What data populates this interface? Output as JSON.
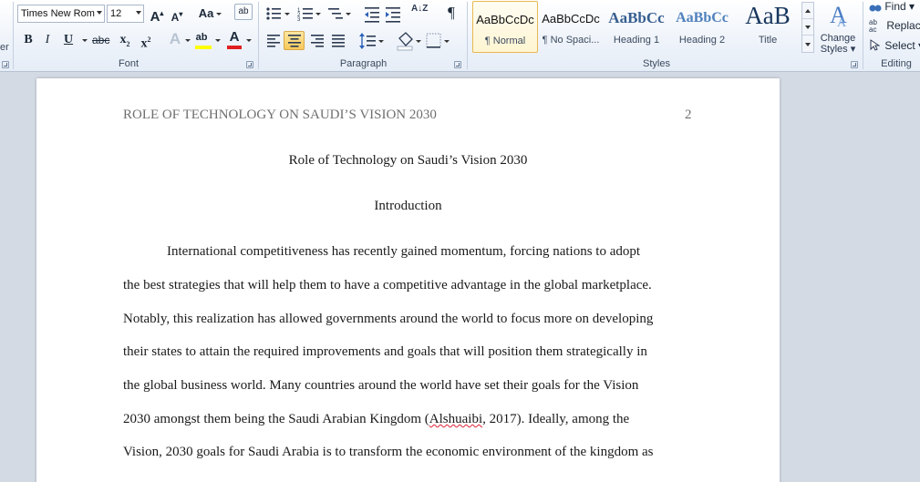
{
  "ribbon": {
    "font": {
      "name_value": "Times New Rom",
      "size_value": "12",
      "label": "Font",
      "grow_glyph": "A",
      "shrink_glyph": "A",
      "case_glyph": "Aa",
      "bold_glyph": "B",
      "italic_glyph": "I",
      "underline_glyph": "U",
      "strike_glyph": "abc",
      "subscript_glyph": "x",
      "superscript_glyph": "x",
      "sub_mark": "2",
      "sup_mark": "2",
      "highlight_glyph": "ab",
      "color_glyph": "A",
      "highlight_color": "#ffff00",
      "font_color": "#e02020"
    },
    "paragraph": {
      "label": "Paragraph",
      "pilcrow": "¶",
      "sort_glyph": "A↓Z"
    },
    "styles": {
      "label": "Styles",
      "tiles": [
        {
          "preview": "AaBbCcDc",
          "name": "¶ Normal"
        },
        {
          "preview": "AaBbCcDc",
          "name": "¶ No Spaci..."
        },
        {
          "preview": "AaBbCc",
          "name": "Heading 1"
        },
        {
          "preview": "AaBbCc",
          "name": "Heading 2"
        },
        {
          "preview": "AaB",
          "name": "Title"
        }
      ],
      "change_styles_line1": "Change",
      "change_styles_line2": "Styles",
      "heading_color": "#365f91"
    },
    "editing": {
      "label": "Editing",
      "find": "Find",
      "replace": "Replace",
      "select": "Select",
      "clip_text": "er"
    }
  },
  "document": {
    "header_title": "ROLE OF TECHNOLOGY ON SAUDI’S VISION 2030",
    "page_number": "2",
    "title": "Role of Technology on Saudi’s Vision 2030",
    "section_heading": "Introduction",
    "lines": [
      "International competitiveness has recently gained momentum, forcing nations to adopt",
      "the best strategies that will help them to have a competitive advantage in the global marketplace.",
      "Notably, this realization has allowed governments around the world to focus more on developing",
      "their states to attain the required improvements and goals that will position them strategically in",
      "the global business world. Many countries around the world have set their goals for the Vision",
      "Vision, 2030 goals for Saudi Arabia is to transform the economic environment of the kingdom as"
    ],
    "line6_before": "2030 amongst them being the Saudi Arabian Kingdom (",
    "citation_author": "Alshuaibi",
    "line6_after": ", 2017). Ideally, among the"
  }
}
